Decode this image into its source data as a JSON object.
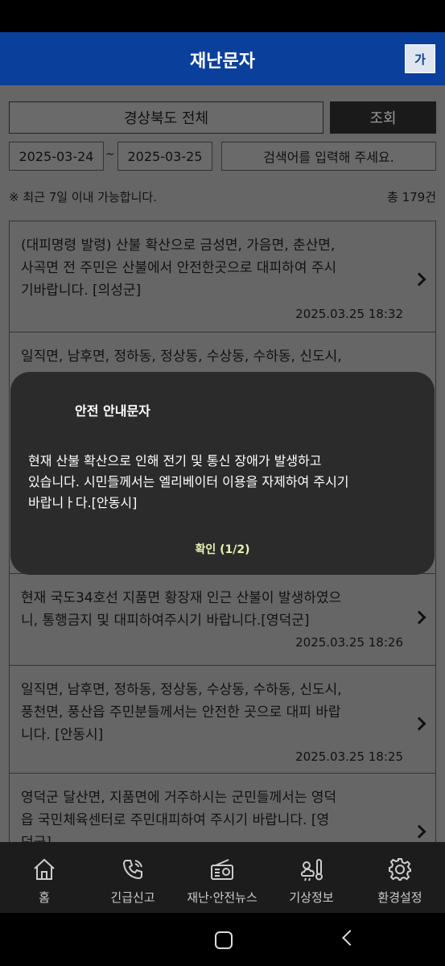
{
  "header": {
    "title": "재난문자",
    "font_size_label": "가"
  },
  "search": {
    "region": "경상북도 전체",
    "query_label": "조회",
    "date_from": "2025-03-24",
    "date_sep": "~",
    "date_to": "2025-03-25",
    "keyword_placeholder": "검색어를 입력해 주세요."
  },
  "notice": {
    "text": "※ 최근 7일 이내 가능합니다.",
    "total": "총 179건"
  },
  "messages": [
    {
      "lines": [
        "(대피명령 발령) 산불 확산으로 금성면, 가음면, 춘산면,",
        "사곡면 전 주민은 산불에서 안전한곳으로 대피하여 주시",
        "기바랍니다. [의성군]"
      ],
      "time": "2025.03.25 18:32"
    },
    {
      "lines": [
        "일직면, 남후면, 정하동, 정상동, 수상동, 수하동, 신도시,"
      ],
      "time": ""
    },
    {
      "lines": [
        "현재 국도34호선 지품면 황장재 인근 산불이 발생하였으",
        "니, 통행금지 및 대피하여주시기 바랍니다.[영덕군]"
      ],
      "time": "2025.03.25 18:26"
    },
    {
      "lines": [
        "일직면, 남후면, 정하동, 정상동, 수상동, 수하동, 신도시,",
        "풍천면, 풍산읍 주민분들께서는 안전한 곳으로 대피 바랍",
        "니다. [안동시]"
      ],
      "time": "2025.03.25 18:25"
    },
    {
      "lines": [
        "영덕군 달산면, 지품면에 거주하시는 군민들께서는 영덕",
        "읍 국민체육센터로 주민대피하여 주시기 바랍니다. [영",
        "덕군]"
      ],
      "time": ""
    }
  ],
  "dialog": {
    "title": "안전 안내문자",
    "body": [
      "현재 산불 확산으로 인해 전기 및 통신 장애가 발생하고",
      "있습니다. 시민들께서는 엘리베이터 이용을 자제하여 주시기",
      "바랍니ㅏ다.[안동시]"
    ],
    "ok_label": "확인 (1/2)"
  },
  "nav": [
    {
      "label": "홈",
      "icon": "home-icon"
    },
    {
      "label": "긴급신고",
      "icon": "phone-icon"
    },
    {
      "label": "재난·안전뉴스",
      "icon": "radio-icon"
    },
    {
      "label": "기상정보",
      "icon": "weather-icon"
    },
    {
      "label": "환경설정",
      "icon": "gear-icon"
    }
  ]
}
